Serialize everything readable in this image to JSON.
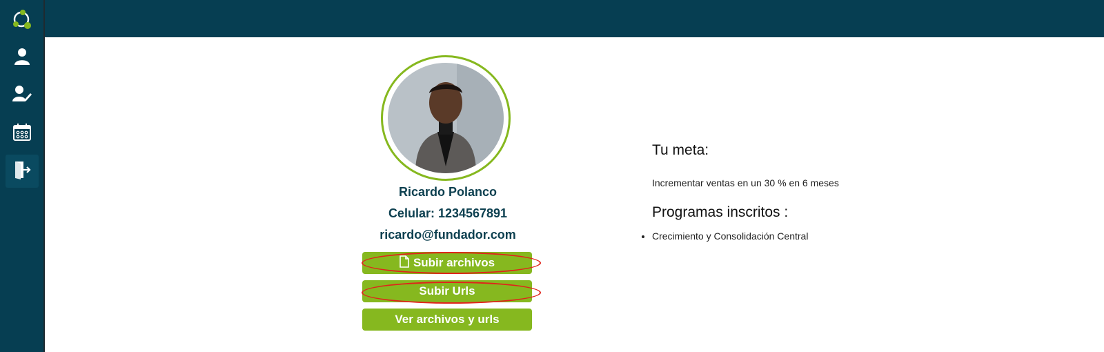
{
  "colors": {
    "navy": "#063e52",
    "accent_green": "#86b81f",
    "text_dark": "#0d4050",
    "annotation_red": "#e0241b"
  },
  "sidebar": {
    "logo_icon": "app-logo-icon",
    "items": [
      {
        "icon": "user-icon"
      },
      {
        "icon": "user-edit-icon"
      },
      {
        "icon": "calendar-icon"
      },
      {
        "icon": "logout-icon"
      }
    ]
  },
  "profile": {
    "name": "Ricardo Polanco",
    "phone": "Celular: 1234567891",
    "email": "ricardo@fundador.com",
    "photo_icon": "profile-photo"
  },
  "actions": {
    "upload_files": {
      "label": "Subir archivos",
      "icon": "file-icon"
    },
    "upload_urls": {
      "label": "Subir Urls"
    },
    "view_files": {
      "label": "Ver archivos y urls"
    }
  },
  "goal": {
    "title": "Tu meta:",
    "text": "Incrementar ventas en un 30 % en 6 meses"
  },
  "programs": {
    "title": "Programas inscritos :",
    "items": [
      "Crecimiento y Consolidación Central"
    ]
  }
}
